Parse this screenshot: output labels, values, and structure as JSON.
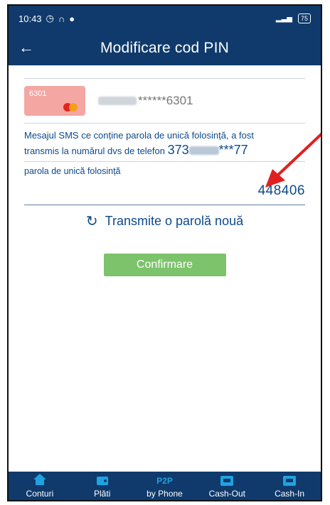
{
  "status_bar": {
    "time": "10:43",
    "signal": "46",
    "battery": "75"
  },
  "header": {
    "back_glyph": "←",
    "title": "Modificare cod PIN"
  },
  "card": {
    "thumb_number": "6301",
    "masked_number": "******6301"
  },
  "sms": {
    "line1": "Mesajul SMS ce conține parola de unică folosință, a fost",
    "line2": "transmis la numărul dvs de telefon",
    "phone_prefix": "373",
    "phone_suffix": "***77"
  },
  "otp": {
    "label": "parola de unică folosință",
    "value": "448406"
  },
  "resend": {
    "label": "Transmite o parolă nouă"
  },
  "confirm": {
    "label": "Confirmare"
  },
  "nav": {
    "items": [
      {
        "label": "Conturi",
        "icon": "home-icon"
      },
      {
        "label": "Plăti",
        "icon": "wallet-icon"
      },
      {
        "label": "by Phone",
        "icon_text": "P2P"
      },
      {
        "label": "Cash-Out",
        "icon": "atm-icon"
      },
      {
        "label": "Cash-In",
        "icon": "atm-icon"
      }
    ]
  },
  "colors": {
    "primary": "#0f3a6b",
    "text_blue": "#0d4a8a",
    "button_green": "#7cc36b",
    "card_pink": "#f4a7a2",
    "annotation_red": "#e02020",
    "nav_icon": "#1fa3e0"
  }
}
